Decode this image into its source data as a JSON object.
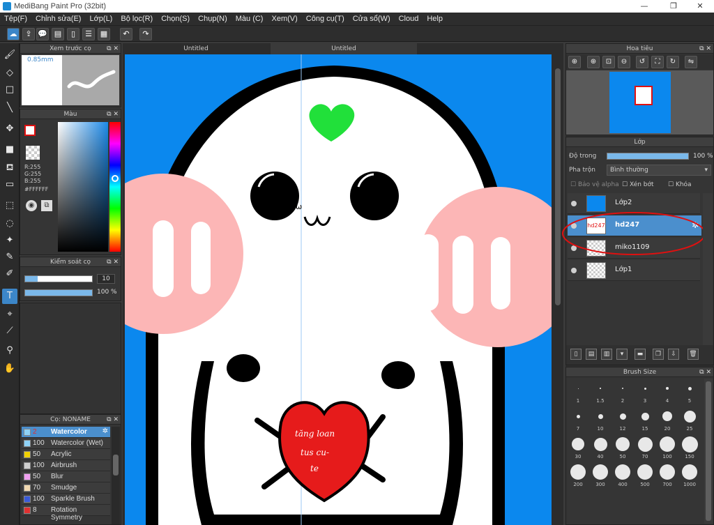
{
  "window": {
    "title": "MediBang Paint Pro (32bit)",
    "minimize": "—",
    "restore": "❐",
    "close": "✕"
  },
  "menu": [
    "Tệp(F)",
    "Chỉnh sửa(E)",
    "Lớp(L)",
    "Bộ lọc(R)",
    "Chọn(S)",
    "Chụp(N)",
    "Màu (C)",
    "Xem(V)",
    "Công cụ(T)",
    "Cửa sổ(W)",
    "Cloud",
    "Help"
  ],
  "tabs": {
    "tab1": "Untitled",
    "tab2": "Untitled"
  },
  "brush_preview": {
    "title": "Xem trước cọ",
    "size": "0.85mm"
  },
  "color_panel": {
    "title": "Màu",
    "r": "R:255",
    "g": "G:255",
    "b": "B:255",
    "hex": "#FFFFFF"
  },
  "brush_control": {
    "title": "Kiểm soát cọ",
    "size": "10",
    "opacity": "100 %"
  },
  "brush_list": {
    "title": "Cọ: NONAME",
    "items": [
      {
        "size": "2",
        "name": "Watercolor",
        "color": "#8fd2f7"
      },
      {
        "size": "100",
        "name": "Watercolor (Wet)",
        "color": "#8fd2f7"
      },
      {
        "size": "50",
        "name": "Acrylic",
        "color": "#f0d000"
      },
      {
        "size": "100",
        "name": "Airbrush",
        "color": "#cfcfcf"
      },
      {
        "size": "50",
        "name": "Blur",
        "color": "#f0a0f0"
      },
      {
        "size": "70",
        "name": "Smudge",
        "color": "#f0d8b0"
      },
      {
        "size": "100",
        "name": "Sparkle Brush",
        "color": "#3a5ad8"
      },
      {
        "size": "8",
        "name": "Rotation Symmetry",
        "color": "#e03030"
      }
    ]
  },
  "navigator": {
    "title": "Hoa tiêu"
  },
  "layer_panel": {
    "title": "Lớp",
    "opacity_label": "Độ trong",
    "opacity_value": "100 %",
    "blend_label": "Pha trộn",
    "blend_value": "Bình thường",
    "protect_alpha": "Bảo vệ alpha",
    "clipping": "Xén bớt",
    "lock": "Khóa",
    "layers": [
      {
        "name": "Lớp2"
      },
      {
        "name": "hd247",
        "thumb_text": "hd247"
      },
      {
        "name": "miko1109"
      },
      {
        "name": "Lớp1"
      }
    ]
  },
  "brush_size": {
    "title": "Brush Size",
    "sizes": [
      "1",
      "1.5",
      "2",
      "3",
      "4",
      "5",
      "7",
      "10",
      "12",
      "15",
      "20",
      "25",
      "30",
      "40",
      "50",
      "70",
      "100",
      "150",
      "200",
      "300",
      "400",
      "500",
      "700",
      "1000"
    ]
  },
  "artwork": {
    "heart_text_line1": "tăng loan",
    "heart_text_line2": "tus cu-",
    "heart_text_line3": "te",
    "mouth": "ω"
  }
}
